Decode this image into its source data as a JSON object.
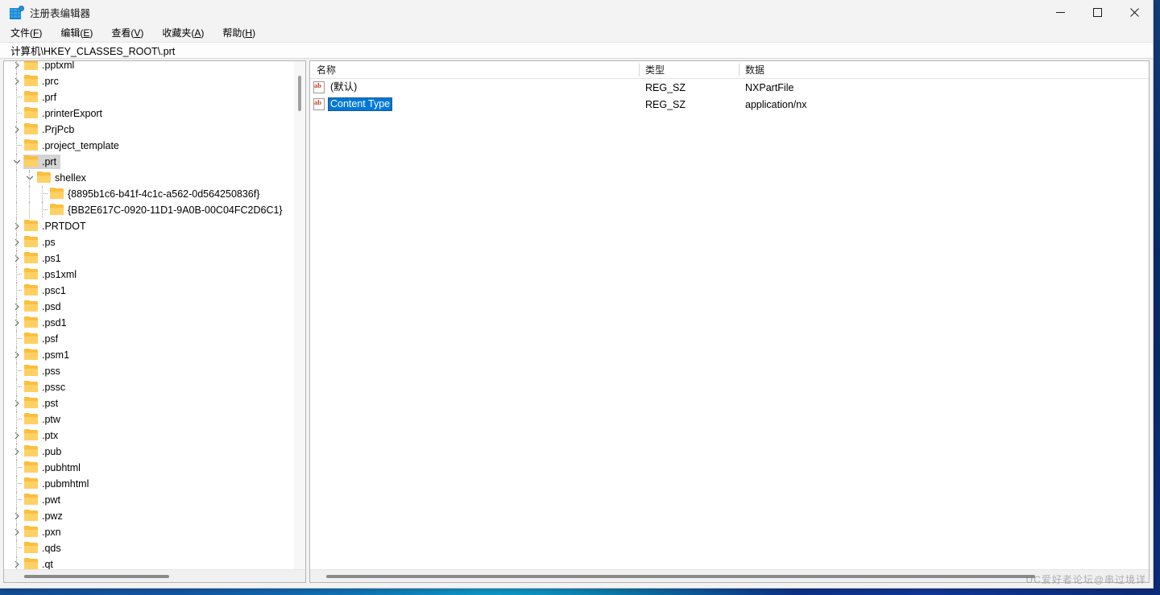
{
  "window": {
    "title": "注册表编辑器",
    "icon": "registry-editor-icon",
    "controls": {
      "minimize": "minimize-icon",
      "maximize": "maximize-icon",
      "close": "close-icon"
    }
  },
  "menu": [
    {
      "label": "文件(F)",
      "text": "文件(",
      "accel": "F",
      "close": ")"
    },
    {
      "label": "编辑(E)",
      "text": "编辑(",
      "accel": "E",
      "close": ")"
    },
    {
      "label": "查看(V)",
      "text": "查看(",
      "accel": "V",
      "close": ")"
    },
    {
      "label": "收藏夹(A)",
      "text": "收藏夹(",
      "accel": "A",
      "close": ")"
    },
    {
      "label": "帮助(H)",
      "text": "帮助(",
      "accel": "H",
      "close": ")"
    }
  ],
  "address": {
    "path": "计算机\\HKEY_CLASSES_ROOT\\.prt"
  },
  "tree": {
    "items": [
      {
        "label": ".pptxml",
        "depth": 0,
        "expander": "collapsed",
        "selected": false
      },
      {
        "label": ".prc",
        "depth": 0,
        "expander": "collapsed",
        "selected": false
      },
      {
        "label": ".prf",
        "depth": 0,
        "expander": "none",
        "selected": false
      },
      {
        "label": ".printerExport",
        "depth": 0,
        "expander": "none",
        "selected": false
      },
      {
        "label": ".PrjPcb",
        "depth": 0,
        "expander": "collapsed",
        "selected": false
      },
      {
        "label": ".project_template",
        "depth": 0,
        "expander": "none",
        "selected": false
      },
      {
        "label": ".prt",
        "depth": 0,
        "expander": "expanded",
        "selected": true
      },
      {
        "label": "shellex",
        "depth": 1,
        "expander": "expanded",
        "selected": false
      },
      {
        "label": "{8895b1c6-b41f-4c1c-a562-0d564250836f}",
        "depth": 2,
        "expander": "none",
        "selected": false
      },
      {
        "label": "{BB2E617C-0920-11D1-9A0B-00C04FC2D6C1}",
        "depth": 2,
        "expander": "none",
        "selected": false
      },
      {
        "label": ".PRTDOT",
        "depth": 0,
        "expander": "collapsed",
        "selected": false
      },
      {
        "label": ".ps",
        "depth": 0,
        "expander": "collapsed",
        "selected": false
      },
      {
        "label": ".ps1",
        "depth": 0,
        "expander": "collapsed",
        "selected": false
      },
      {
        "label": ".ps1xml",
        "depth": 0,
        "expander": "none",
        "selected": false
      },
      {
        "label": ".psc1",
        "depth": 0,
        "expander": "none",
        "selected": false
      },
      {
        "label": ".psd",
        "depth": 0,
        "expander": "collapsed",
        "selected": false
      },
      {
        "label": ".psd1",
        "depth": 0,
        "expander": "collapsed",
        "selected": false
      },
      {
        "label": ".psf",
        "depth": 0,
        "expander": "none",
        "selected": false
      },
      {
        "label": ".psm1",
        "depth": 0,
        "expander": "collapsed",
        "selected": false
      },
      {
        "label": ".pss",
        "depth": 0,
        "expander": "none",
        "selected": false
      },
      {
        "label": ".pssc",
        "depth": 0,
        "expander": "none",
        "selected": false
      },
      {
        "label": ".pst",
        "depth": 0,
        "expander": "collapsed",
        "selected": false
      },
      {
        "label": ".ptw",
        "depth": 0,
        "expander": "none",
        "selected": false
      },
      {
        "label": ".ptx",
        "depth": 0,
        "expander": "collapsed",
        "selected": false
      },
      {
        "label": ".pub",
        "depth": 0,
        "expander": "collapsed",
        "selected": false
      },
      {
        "label": ".pubhtml",
        "depth": 0,
        "expander": "none",
        "selected": false
      },
      {
        "label": ".pubmhtml",
        "depth": 0,
        "expander": "none",
        "selected": false
      },
      {
        "label": ".pwt",
        "depth": 0,
        "expander": "none",
        "selected": false
      },
      {
        "label": ".pwz",
        "depth": 0,
        "expander": "collapsed",
        "selected": false
      },
      {
        "label": ".pxn",
        "depth": 0,
        "expander": "collapsed",
        "selected": false
      },
      {
        "label": ".qds",
        "depth": 0,
        "expander": "none",
        "selected": false
      },
      {
        "label": ".qt",
        "depth": 0,
        "expander": "collapsed",
        "selected": false
      }
    ]
  },
  "values": {
    "columns": [
      "名称",
      "类型",
      "数据"
    ],
    "rows": [
      {
        "name": "(默认)",
        "type": "REG_SZ",
        "data": "NXPartFile",
        "icon": "string-value-icon",
        "selected": false
      },
      {
        "name": "Content Type",
        "type": "REG_SZ",
        "data": "application/nx",
        "icon": "string-value-icon",
        "selected": true
      }
    ]
  },
  "watermark": {
    "text": "UC爱好者论坛@串过境详"
  },
  "colors": {
    "selection_blue": "#0078d7",
    "tree_selection_gray": "#d4d4d4",
    "folder_yellow": "#fdbe3d",
    "value_icon_red": "#d03a1c"
  }
}
